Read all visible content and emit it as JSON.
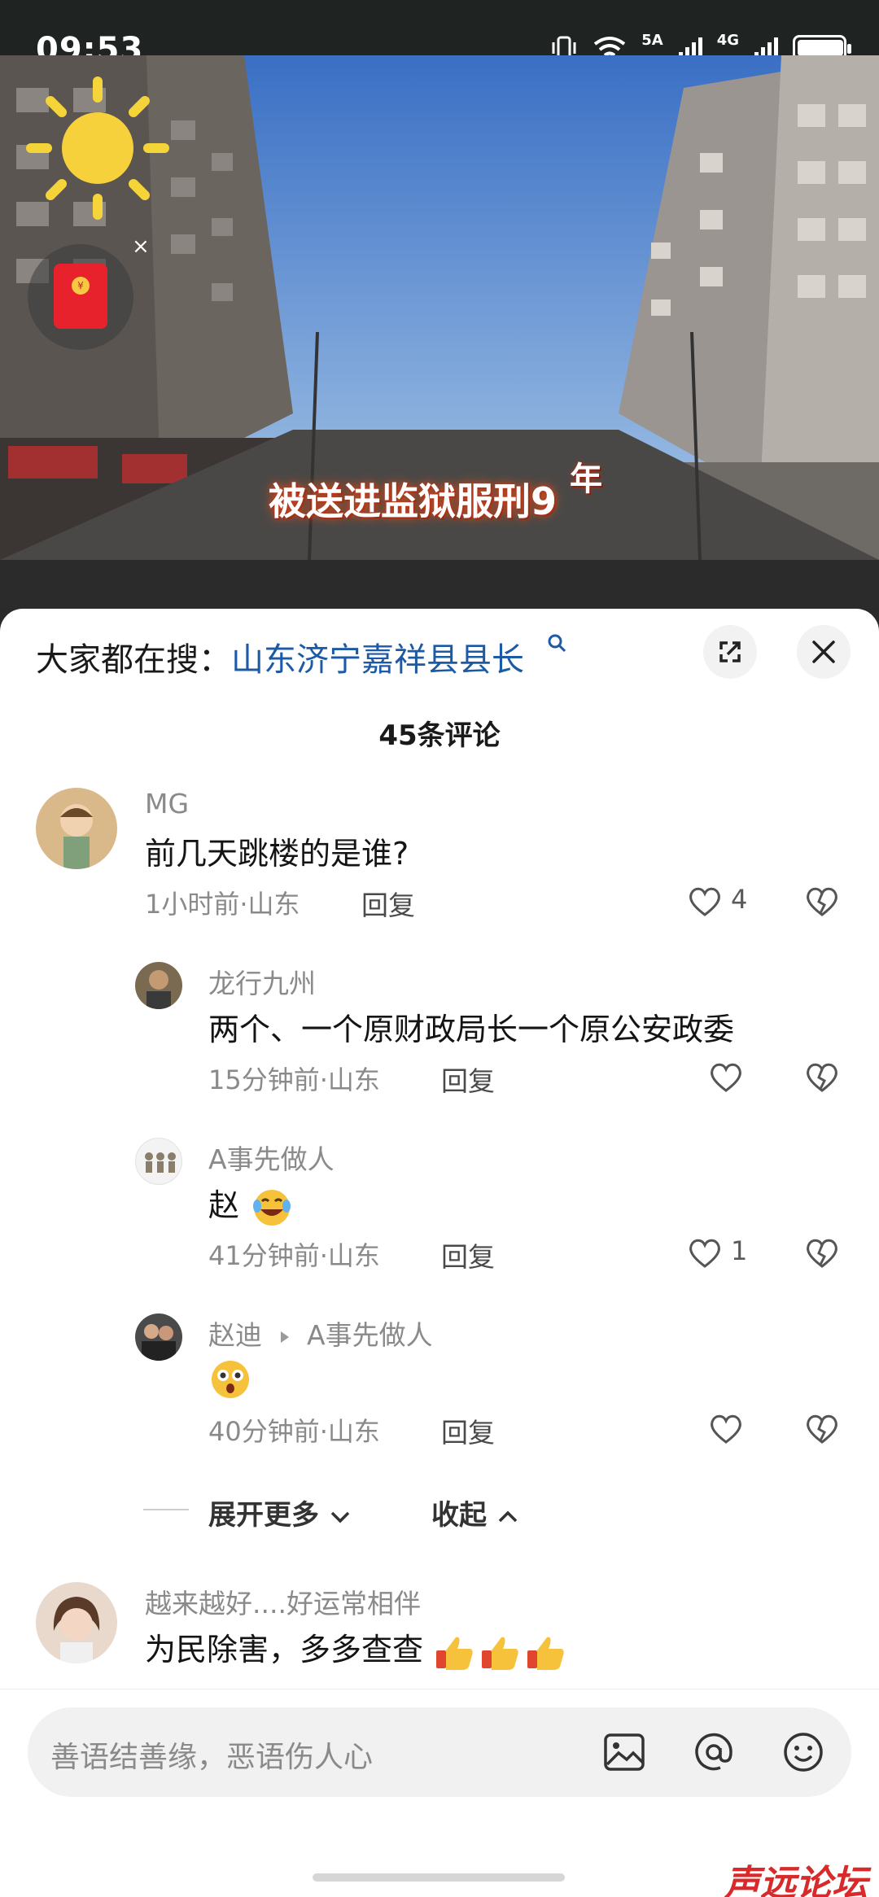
{
  "status_bar": {
    "time": "09:53",
    "network_1": "5A",
    "network_2": "4G"
  },
  "video": {
    "subtitle": "被送进监狱服刑9",
    "subtitle_year": "年",
    "redpacket_close": "×",
    "redpacket_symbol": "¥"
  },
  "sheet": {
    "search_prefix": "大家都在搜：",
    "search_term": "山东济宁嘉祥县县长",
    "comment_count": "45条评论"
  },
  "comments": [
    {
      "name": "MG",
      "text": "前几天跳楼的是谁?",
      "meta": "1小时前·山东",
      "reply": "回复",
      "likes": "4"
    },
    {
      "name": "龙行九州",
      "text": "两个、一个原财政局长一个原公安政委",
      "meta": "15分钟前·山东",
      "reply": "回复",
      "likes": ""
    },
    {
      "name": "A事先做人",
      "text": "赵",
      "meta": "41分钟前·山东",
      "reply": "回复",
      "likes": "1"
    },
    {
      "name": "赵迪",
      "reply_to": "A事先做人",
      "text": "",
      "meta": "40分钟前·山东",
      "reply": "回复",
      "likes": ""
    },
    {
      "name": "越来越好....好运常相伴",
      "text": "为民除害，多多查查"
    }
  ],
  "expand": {
    "more": "展开更多",
    "collapse": "收起"
  },
  "input": {
    "placeholder": "善语结善缘，恶语伤人心"
  },
  "watermark": "声远论坛"
}
